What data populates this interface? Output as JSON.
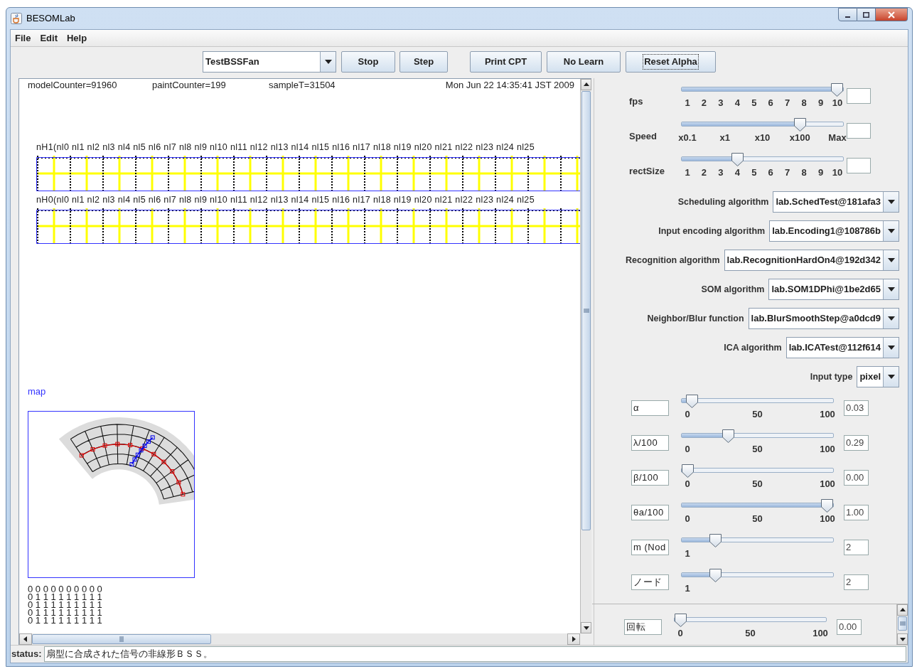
{
  "window": {
    "title": "BESOMLab"
  },
  "menu": [
    {
      "label": "File"
    },
    {
      "label": "Edit"
    },
    {
      "label": "Help"
    }
  ],
  "toolbar": {
    "scenario": "TestBSSFan",
    "run_buttons": [
      {
        "label": "Stop",
        "focused": false
      },
      {
        "label": "Step",
        "focused": false
      }
    ],
    "action_buttons": [
      {
        "label": "Print CPT",
        "focused": false
      },
      {
        "label": "No Learn",
        "focused": false
      },
      {
        "label": "Reset Alpha",
        "focused": true
      }
    ]
  },
  "view": {
    "stats": [
      "modelCounter=91960",
      "paintCounter=199",
      "sampleT=31504"
    ],
    "timestamp": "Mon Jun 22 14:35:41 JST 2009",
    "layers": [
      {
        "label": "nH1(nl0 nl1 nl2 nl3 nl4 nl5 nl6 nl7 nl8 nl9 nl10 nl11 nl12 nl13 nl14 nl15 nl16 nl17 nl18 nl19 nl20 nl21 nl22 nl23 nl24 nl25"
      },
      {
        "label": "nH0(nl0 nl1 nl2 nl3 nl4 nl5 nl6 nl7 nl8 nl9 nl10 nl11 nl12 nl13 nl14 nl15 nl16 nl17 nl18 nl19 nl20 nl21 nl22 nl23 nl24 nl25"
      }
    ],
    "map_label": "map",
    "matrix": [
      "0 0 0 0 0 0 0 0 0 0",
      "0 1 1 1 1 1 1 1 1 1",
      "0 1 1 1 1 1 1 1 1 1",
      "0 1 1 1 1 1 1 1 1 1",
      "0 1 1 1 1 1 1 1 1 1"
    ]
  },
  "display_sliders": [
    {
      "label": "fps",
      "ticks": [
        "1",
        "2",
        "3",
        "4",
        "5",
        "6",
        "7",
        "8",
        "9",
        "10"
      ],
      "level": 1
    },
    {
      "label": "Speed",
      "ticks": [
        "x0.1",
        "x1",
        "x10",
        "x100",
        "Max"
      ],
      "level": 0.75
    },
    {
      "label": "rectSize",
      "ticks": [
        "1",
        "2",
        "3",
        "4",
        "5",
        "6",
        "7",
        "8",
        "9",
        "10"
      ],
      "level": 0.333
    }
  ],
  "algorithms": [
    {
      "label": "Scheduling algorithm",
      "value": "lab.SchedTest@181afa3"
    },
    {
      "label": "Input encoding algorithm",
      "value": "lab.Encoding1@108786b"
    },
    {
      "label": "Recognition algorithm",
      "value": "lab.RecognitionHardOn4@192d342"
    },
    {
      "label": "SOM algorithm",
      "value": "lab.SOM1DPhi@1be2d65"
    },
    {
      "label": "Neighbor/Blur function",
      "value": "lab.BlurSmoothStep@a0dcd9"
    },
    {
      "label": "ICA algorithm",
      "value": "lab.ICATest@112f614"
    },
    {
      "label": "Input type",
      "value": "pixel"
    }
  ],
  "parameters": [
    {
      "name": "α",
      "ticks": [
        "0",
        "50",
        "100"
      ],
      "level": 0.03,
      "value": "0.03"
    },
    {
      "name": "λ/100",
      "ticks": [
        "0",
        "50",
        "100"
      ],
      "level": 0.29,
      "value": "0.29"
    },
    {
      "name": "β/100",
      "ticks": [
        "0",
        "50",
        "100"
      ],
      "level": 0,
      "value": "0.00"
    },
    {
      "name": "θa/100",
      "ticks": [
        "0",
        "50",
        "100"
      ],
      "level": 1,
      "value": "1.00"
    },
    {
      "name": "m (Nod",
      "ticks": [
        "1"
      ],
      "level": 0.2,
      "value": "2"
    },
    {
      "name": "ノード",
      "ticks": [
        "1"
      ],
      "level": 0.2,
      "value": "2"
    }
  ],
  "extra_parameters": [
    {
      "name": "回転",
      "ticks": [
        "0",
        "50",
        "100"
      ],
      "level": 0,
      "value": "0.00"
    }
  ],
  "status": {
    "label": "status:",
    "text": "扇型に合成された信号の非線形ＢＳＳ。"
  }
}
